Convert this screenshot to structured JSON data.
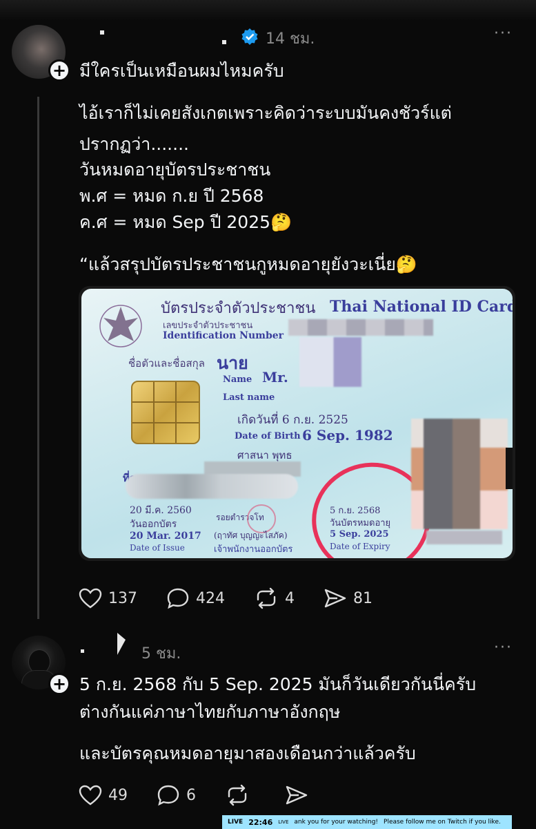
{
  "post1": {
    "time": "14 ชม.",
    "more": "···",
    "headline": "มีใครเป็นเหมือนผมไหมครับ",
    "body_lines": [
      "ไอ้เราก็ไม่เคยสังเกตเพราะคิดว่าระบบมันคงชัวร์แต่",
      "ปรากฏว่า.......",
      "วันหมดอายุบัตรประชาชน",
      "พ.ศ = หมด ก.ย ปี 2568",
      "ค.ศ = หมด Sep ปี 2025🤔"
    ],
    "quote": "“แล้วสรุปบัตรประชาชนกูหมดอายุยังวะเนี่ย🤔",
    "likes": "137",
    "comments": "424",
    "reposts": "4",
    "shares": "81"
  },
  "card": {
    "title_th": "บัตรประจำตัวประชาชน",
    "title_en": "Thai National ID Card",
    "idnum_th": "เลขประจำตัวประชาชน",
    "idnum_en": "Identification Number",
    "name_th_label": "ชื่อตัวและชื่อสกุล",
    "name_th_prefix": "นาย",
    "name_en_label": "Name",
    "name_en_prefix": "Mr.",
    "lastname_label": "Last name",
    "dob_th": "เกิดวันที่  6 ก.ย. 2525",
    "dob_en_label": "Date of Birth",
    "dob_en": "6 Sep. 1982",
    "religion": "ศาสนา  พุทธ",
    "address_label": "ที่อ",
    "issue_th": "20 มี.ค. 2560",
    "issue_th_label": "วันออกบัตร",
    "issue_en": "20 Mar. 2017",
    "issue_en_label": "Date of Issue",
    "signer_a": "รอยตำรวจโท",
    "signer_b": "(ฤาทัศ  บุญญะไสภัค)",
    "officer": "เจ้าพนักงานออกบัตร",
    "expiry_th": "5 ก.ย. 2568",
    "expiry_th_label": "วันบัตรหมดอายุ",
    "expiry_en": "5 Sep. 2025",
    "expiry_en_label": "Date of Expiry"
  },
  "post2": {
    "time": "5 ชม.",
    "more": "···",
    "body_lines": [
      "5 ก.ย. 2568 กับ 5 Sep. 2025 มันก็วันเดียวกันนี่ครับ",
      "ต่างกันแค่ภาษาไทยกับภาษาอังกฤษ"
    ],
    "body2": "และบัตรคุณหมดอายุมาสองเดือนกว่าแล้วครับ",
    "likes": "49",
    "comments": "6"
  },
  "overlay": {
    "live": "LIVE",
    "clock": "22:46",
    "tag": "LIVE",
    "msg1": "ank you for your watching!",
    "msg2": "Please follow me on Twitch if you like."
  }
}
